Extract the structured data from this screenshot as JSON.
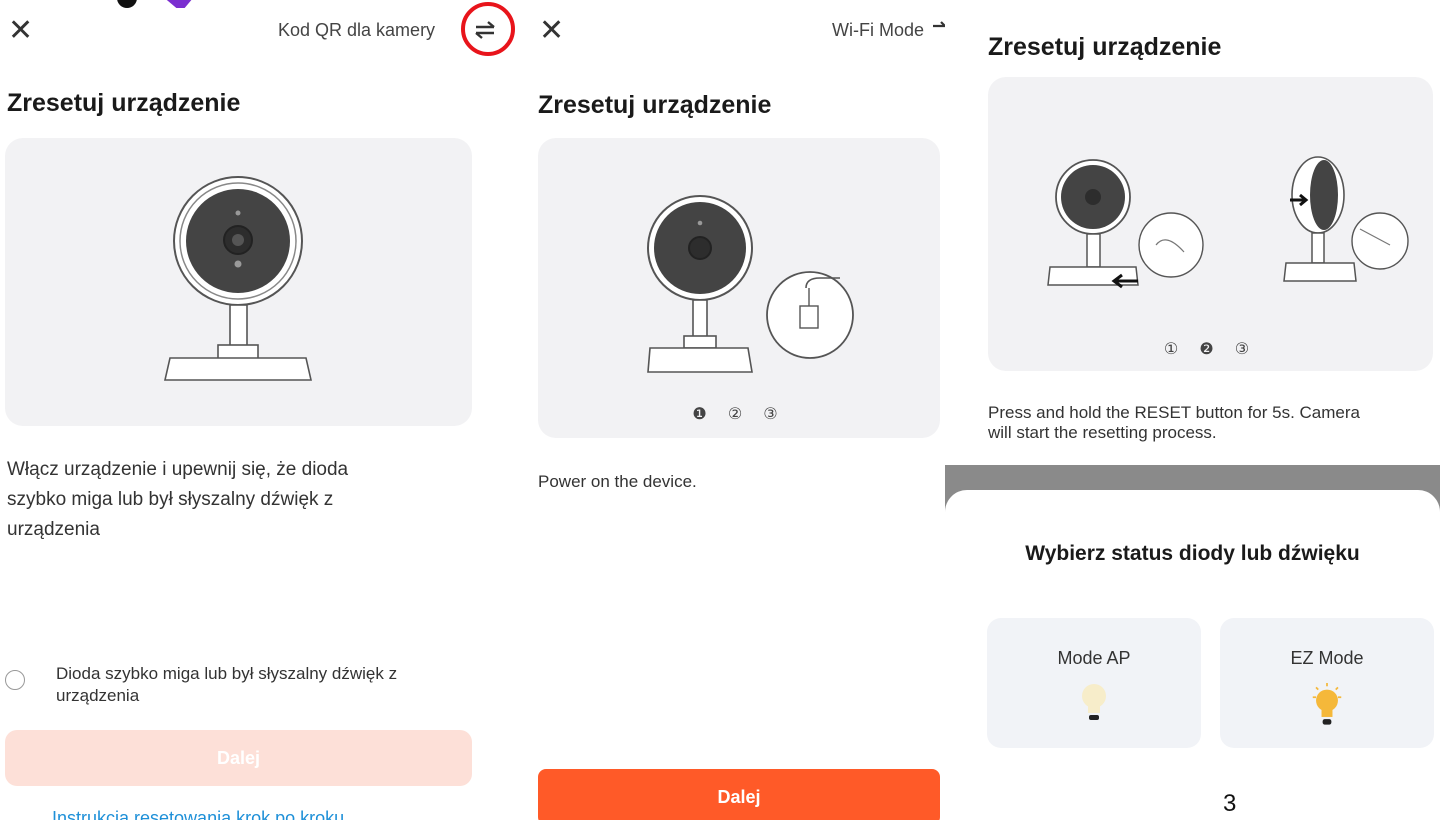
{
  "panel1": {
    "close_icon": "close-icon",
    "top_link": "Kod QR dla kamery",
    "switch_icon": "swap-arrows-icon",
    "title": "Zresetuj urządzenie",
    "description_lines": [
      "Włącz urządzenie i upewnij się, że dioda",
      "szybko miga lub był słyszalny dźwięk z",
      "urządzenia"
    ],
    "checkbox_label_lines": [
      "Dioda szybko miga lub był słyszalny dźwięk z",
      "urządzenia"
    ],
    "button_label": "Dalej",
    "bottom_link": "Instrukcja resetowania krok po kroku"
  },
  "panel2": {
    "close_icon": "close-icon",
    "top_link": "Wi-Fi Mode",
    "title": "Zresetuj urządzenie",
    "step_indicator": "❶ ② ③",
    "description": "Power on the device.",
    "button_label": "Dalej"
  },
  "panel3": {
    "title": "Zresetuj urządzenie",
    "step_indicator": "① ❷ ③",
    "description_lines": [
      "Press and hold the RESET button for 5s. Camera",
      "will start the resetting process."
    ],
    "sheet_title": "Wybierz status diody lub dźwięku",
    "options": [
      {
        "label": "Mode AP",
        "icon": "bulb-dim-icon"
      },
      {
        "label": "EZ Mode",
        "icon": "bulb-lit-icon"
      }
    ]
  },
  "page_number": "3",
  "colors": {
    "accent": "#ff5a28",
    "accent_disabled": "#fde0d8",
    "link": "#1e90d8",
    "highlight_ring": "#e8141b",
    "card_bg": "#f2f2f4"
  }
}
